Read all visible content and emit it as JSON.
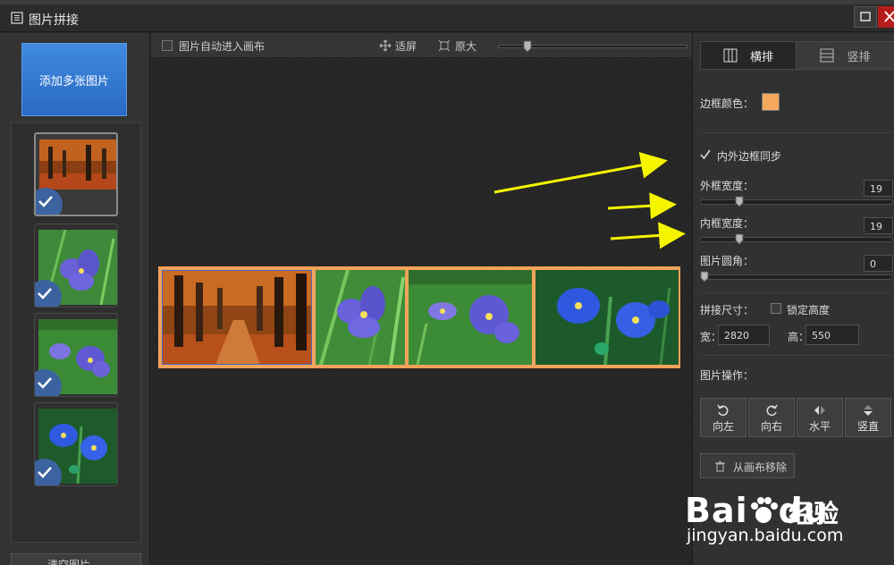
{
  "window": {
    "title": "图片拼接"
  },
  "left_panel": {
    "add_button": "添加多张图片",
    "clear_button": "清空图片",
    "thumbnails": [
      {
        "name": "autumn-forest",
        "checked": true,
        "selected": true
      },
      {
        "name": "purple-flower",
        "checked": true,
        "selected": false
      },
      {
        "name": "purple-flowers-pair",
        "checked": true,
        "selected": false
      },
      {
        "name": "blue-flowers",
        "checked": true,
        "selected": false
      }
    ]
  },
  "canvas_toolbar": {
    "auto_enter_label": "图片自动进入画布",
    "auto_enter_checked": false,
    "fit_label": "适屏",
    "original_label": "原大",
    "zoom_level": 0.14
  },
  "right_panel": {
    "tabs": [
      {
        "label": "横排",
        "active": true
      },
      {
        "label": "竖排",
        "active": false
      }
    ],
    "border_color_label": "边框颜色：",
    "border_color": "#f5a95c",
    "sync_label": "内外边框同步",
    "sync_checked": true,
    "outer_width": {
      "label": "外框宽度：",
      "value": "19",
      "fraction": 0.19
    },
    "inner_width": {
      "label": "内框宽度：",
      "value": "19",
      "fraction": 0.19
    },
    "corner_radius": {
      "label": "图片圆角：",
      "value": "0",
      "fraction": 0.0
    },
    "size_label": "拼接尺寸：",
    "lock_height_label": "锁定高度",
    "lock_height_checked": false,
    "width_label": "宽：",
    "width_value": "2820",
    "height_label": "高：",
    "height_value": "550",
    "operations_label": "图片操作：",
    "operations": [
      {
        "label": "向左",
        "icon": "rotate-left-icon"
      },
      {
        "label": "向右",
        "icon": "rotate-right-icon"
      },
      {
        "label": "水平",
        "icon": "flip-horizontal-icon"
      },
      {
        "label": "竖直",
        "icon": "flip-vertical-icon"
      }
    ],
    "remove_label": "从画布移除"
  },
  "watermark": {
    "brand": "Bai",
    "brand_suffix": "du",
    "product": "经验",
    "url": "jingyan.baidu.com"
  },
  "colors": {
    "accent_blue": "#2f74d0",
    "annotation_arrow": "#f5f500",
    "stitch_border": "#f2a35b"
  }
}
